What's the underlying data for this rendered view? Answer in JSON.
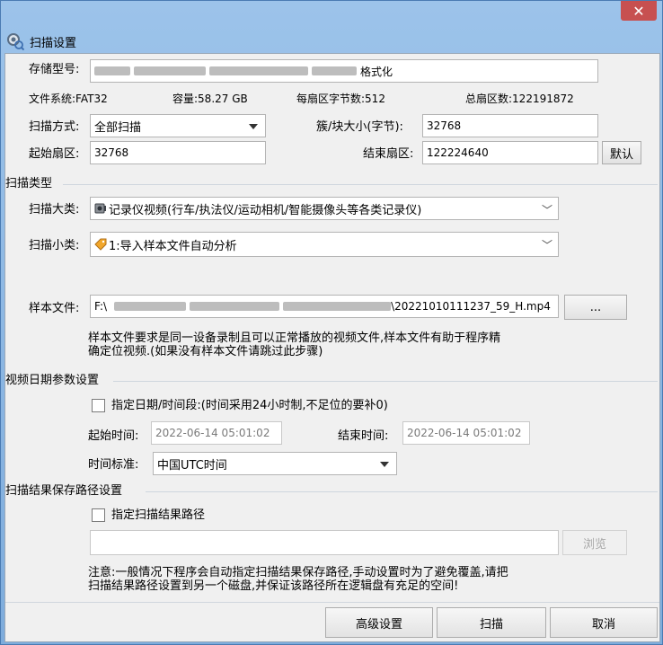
{
  "window": {
    "title": "扫描设置",
    "close_glyph": "✕"
  },
  "storage": {
    "model_label": "存储型号:",
    "model_value_tail": "格式化",
    "fs_label": "文件系统:",
    "fs_value": "FAT32",
    "capacity_label": "容量:",
    "capacity_value": "58.27 GB",
    "bytes_label": "每扇区字节数:",
    "bytes_value": "512",
    "total_label": "总扇区数:",
    "total_value": "122191872",
    "scan_mode_label": "扫描方式:",
    "scan_mode_value": "全部扫描",
    "cluster_label": "簇/块大小(字节):",
    "cluster_value": "32768",
    "start_sector_label": "起始扇区:",
    "start_sector_value": "32768",
    "end_sector_label": "结束扇区:",
    "end_sector_value": "122224640",
    "default_button": "默认"
  },
  "scan_type": {
    "group_label": "扫描类型",
    "major_label": "扫描大类:",
    "major_value": "记录仪视频(行车/执法仪/运动相机/智能摄像头等各类记录仪)",
    "minor_label": "扫描小类:",
    "minor_value": "1:导入样本文件自动分析",
    "sample_label": "样本文件:",
    "sample_prefix": "F:\\",
    "sample_suffix": "\\20221010111237_59_H.mp4",
    "browse_button": "...",
    "note_line1": "样本文件要求是同一设备录制且可以正常播放的视频文件,样本文件有助于程序精",
    "note_line2": "确定位视频.(如果没有样本文件请跳过此步骤)"
  },
  "video_date": {
    "group_label": "视频日期参数设置",
    "check_label": "指定日期/时间段:(时间采用24小时制,不足位的要补0)",
    "start_label": "起始时间:",
    "start_value": "2022-06-14 05:01:02",
    "end_label": "结束时间:",
    "end_value": "2022-06-14 05:01:02",
    "tz_label": "时间标准:",
    "tz_value": "中国UTC时间"
  },
  "result_path": {
    "group_label": "扫描结果保存路径设置",
    "check_label": "指定扫描结果路径",
    "path_value": "",
    "browse_button": "浏览",
    "note_line1": "注意:一般情况下程序会自动指定扫描结果保存路径,手动设置时为了避免覆盖,请把",
    "note_line2": "扫描结果路径设置到另一个磁盘,并保证该路径所在逻辑盘有充足的空间!"
  },
  "footer": {
    "advanced_button": "高级设置",
    "scan_button": "扫描",
    "cancel_button": "取消"
  },
  "icons": {
    "title": "gear-magnifier-icon",
    "major": "recorder-icon",
    "minor": "tag-icon"
  }
}
